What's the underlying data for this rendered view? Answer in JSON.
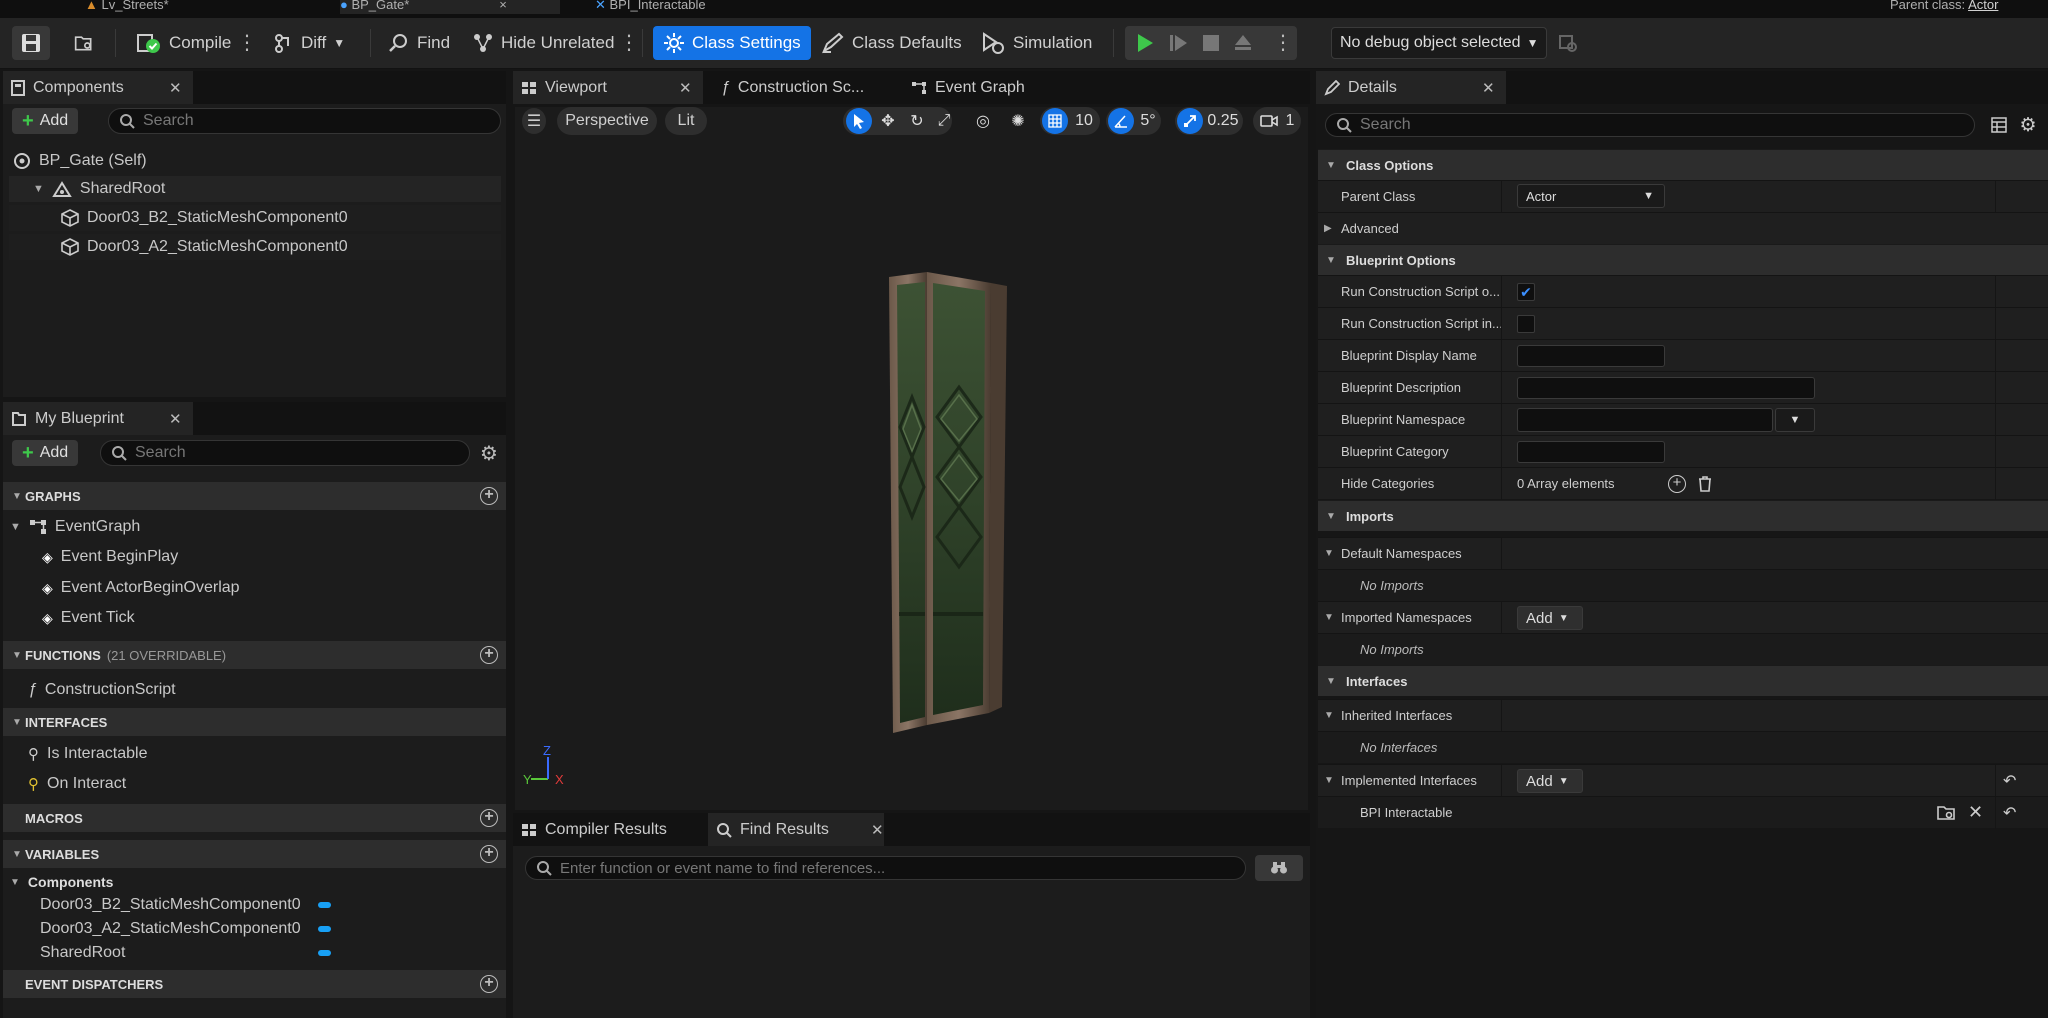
{
  "titlebar": {
    "tabs": [
      {
        "label": "Lv_Streets*"
      },
      {
        "label": "BP_Gate*"
      },
      {
        "label": "BPI_Interactable"
      }
    ],
    "parent_class_label": "Parent class:",
    "parent_class_value": "Actor"
  },
  "toolbar": {
    "compile": "Compile",
    "diff": "Diff",
    "find": "Find",
    "hide_unrelated": "Hide Unrelated",
    "class_settings": "Class Settings",
    "class_defaults": "Class Defaults",
    "simulation": "Simulation",
    "debug_object": "No debug object selected"
  },
  "components": {
    "tab": "Components",
    "add": "Add",
    "search_placeholder": "Search",
    "items": [
      {
        "label": "BP_Gate (Self)"
      },
      {
        "label": "SharedRoot"
      },
      {
        "label": "Door03_B2_StaticMeshComponent0"
      },
      {
        "label": "Door03_A2_StaticMeshComponent0"
      }
    ]
  },
  "my_blueprint": {
    "tab": "My Blueprint",
    "add": "Add",
    "search_placeholder": "Search",
    "graphs_header": "GRAPHS",
    "event_graph": "EventGraph",
    "events": [
      "Event BeginPlay",
      "Event ActorBeginOverlap",
      "Event Tick"
    ],
    "functions_header": "FUNCTIONS",
    "functions_note": "(21 OVERRIDABLE)",
    "functions": [
      "ConstructionScript"
    ],
    "interfaces_header": "INTERFACES",
    "interfaces": [
      "Is Interactable",
      "On Interact"
    ],
    "macros_header": "MACROS",
    "variables_header": "VARIABLES",
    "variables_category": "Components",
    "variables": [
      "Door03_B2_StaticMeshComponent0",
      "Door03_A2_StaticMeshComponent0",
      "SharedRoot"
    ],
    "dispatchers_header": "EVENT DISPATCHERS"
  },
  "center_tabs": {
    "viewport": "Viewport",
    "construction": "Construction Sc...",
    "event_graph": "Event Graph"
  },
  "viewport_bar": {
    "perspective": "Perspective",
    "lit": "Lit",
    "grid_value": "10",
    "angle_value": "5°",
    "scale_value": "0.25",
    "camera_value": "1"
  },
  "bottom_tabs": {
    "compiler_results": "Compiler Results",
    "find_results": "Find Results",
    "find_placeholder": "Enter function or event name to find references..."
  },
  "details": {
    "tab": "Details",
    "search_placeholder": "Search",
    "class_options": "Class Options",
    "parent_class_label": "Parent Class",
    "parent_class_value": "Actor",
    "advanced": "Advanced",
    "blueprint_options": "Blueprint Options",
    "run_cs_ondrag": "Run Construction Script o...",
    "run_cs_sequencer": "Run Construction Script in...",
    "display_name": "Blueprint Display Name",
    "description": "Blueprint Description",
    "namespace": "Blueprint Namespace",
    "category": "Blueprint Category",
    "hide_categories": "Hide Categories",
    "hide_categories_value": "0 Array elements",
    "imports": "Imports",
    "default_namespaces": "Default Namespaces",
    "no_imports": "No Imports",
    "imported_namespaces": "Imported Namespaces",
    "add": "Add",
    "interfaces": "Interfaces",
    "inherited_interfaces": "Inherited Interfaces",
    "no_interfaces": "No Interfaces",
    "implemented_interfaces": "Implemented Interfaces",
    "bpi_interactable": "BPI Interactable"
  },
  "colors": {
    "accent": "#1473e6",
    "play_green": "#3ec84b",
    "variable_pill": "#18a0f5"
  }
}
